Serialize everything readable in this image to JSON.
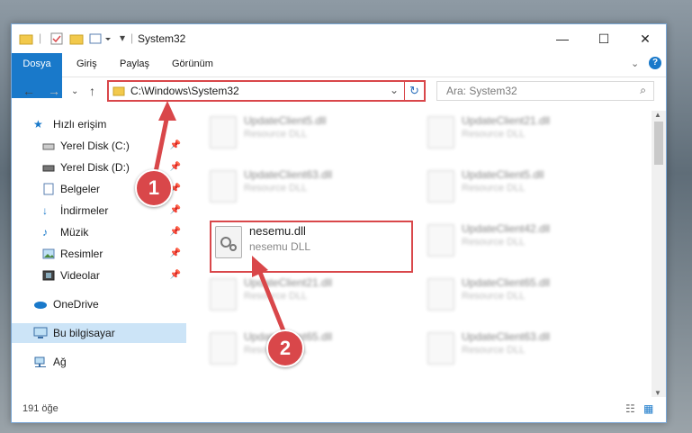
{
  "window": {
    "title": "System32",
    "minimize": "—",
    "maximize": "☐",
    "close": "✕"
  },
  "ribbon": {
    "tabs": [
      "Dosya",
      "Giriş",
      "Paylaş",
      "Görünüm"
    ]
  },
  "address": {
    "path": "C:\\Windows\\System32",
    "search_placeholder": "Ara: System32"
  },
  "sidebar": {
    "items": [
      {
        "label": "Hızlı erişim",
        "icon": "star-icon"
      },
      {
        "label": "Yerel Disk (C:)",
        "icon": "drive-icon"
      },
      {
        "label": "Yerel Disk (D:)",
        "icon": "drive-icon"
      },
      {
        "label": "Belgeler",
        "icon": "documents-icon"
      },
      {
        "label": "İndirmeler",
        "icon": "download-icon"
      },
      {
        "label": "Müzik",
        "icon": "music-icon"
      },
      {
        "label": "Resimler",
        "icon": "pictures-icon"
      },
      {
        "label": "Videolar",
        "icon": "videos-icon"
      },
      {
        "label": "OneDrive",
        "icon": "cloud-icon"
      },
      {
        "label": "Bu bilgisayar",
        "icon": "computer-icon"
      },
      {
        "label": "Ağ",
        "icon": "network-icon"
      }
    ]
  },
  "files": [
    {
      "name": "UpdateClient5.dll",
      "desc": "Resource DLL"
    },
    {
      "name": "UpdateClient21.dll",
      "desc": "Resource DLL"
    },
    {
      "name": "UpdateClient63.dll",
      "desc": "Resource DLL"
    },
    {
      "name": "UpdateClient5.dll",
      "desc": "Resource DLL"
    },
    {
      "name": "nesemu.dll",
      "desc": "nesemu DLL"
    },
    {
      "name": "UpdateClient42.dll",
      "desc": "Resource DLL"
    },
    {
      "name": "UpdateClient21.dll",
      "desc": "Resource DLL"
    },
    {
      "name": "UpdateClient65.dll",
      "desc": "Resource DLL"
    },
    {
      "name": "UpdateClient65.dll",
      "desc": "Resource DLL"
    },
    {
      "name": "UpdateClient63.dll",
      "desc": "Resource DLL"
    }
  ],
  "status": {
    "count": "191 öğe"
  },
  "callouts": [
    "1",
    "2"
  ],
  "colors": {
    "accent": "#1979ca",
    "highlight": "#d9474a"
  }
}
